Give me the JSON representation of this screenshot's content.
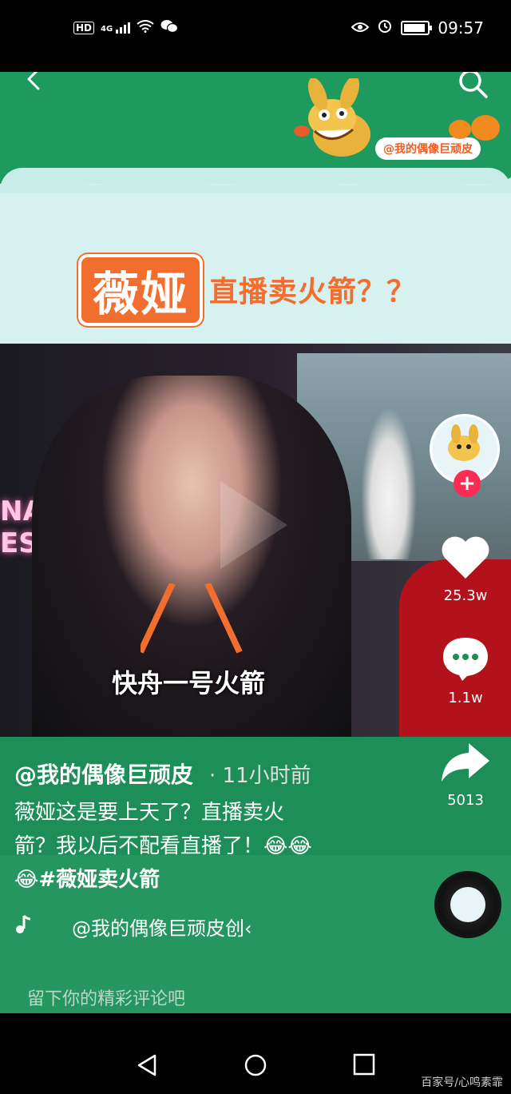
{
  "status_bar": {
    "left_icons": [
      "hd-icon",
      "4g-signal-icon",
      "wifi-icon",
      "wechat-icon"
    ],
    "hd": "HD",
    "network": "4G",
    "time": "09:57"
  },
  "banner": {
    "name": "薇娅",
    "subtitle": "直播卖火箭？？",
    "tag": "@我的偶像巨顽皮"
  },
  "video": {
    "caption": "快舟一号火箭",
    "neon_line1": "NACK",
    "neon_line2": "ESTIVAL"
  },
  "post": {
    "author": "@我的偶像巨顽皮",
    "time_ago": "· 11小时前",
    "desc_line1": "薇娅这是要上天了？直播卖火",
    "desc_line2": "箭？我以后不配看直播了！😂😂",
    "desc_line3_emoji": "😂",
    "hashtag": "#薇娅卖火箭",
    "music": "@我的偶像巨顽皮创‹"
  },
  "actions": {
    "likes": "25.3w",
    "comments": "1.1w",
    "shares": "5013",
    "follow_label": "+"
  },
  "comment_input": {
    "placeholder": "留下你的精彩评论吧"
  },
  "watermark": "百家号/心鸣素霏",
  "colors": {
    "brand_green": "#1e9a5f",
    "accent_orange": "#f26e2e",
    "follow_red": "#fe2c55"
  }
}
